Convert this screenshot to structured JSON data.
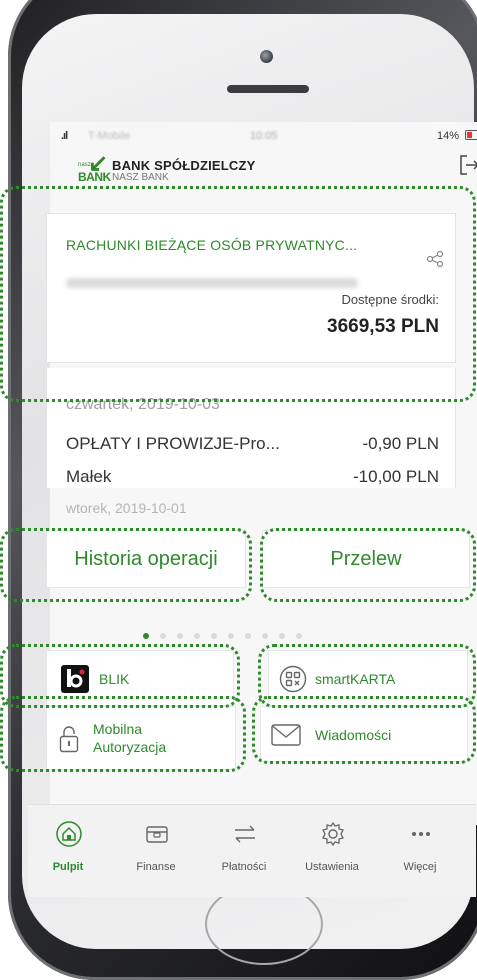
{
  "status_bar": {
    "carrier": "T-Mobile",
    "time": "10:05",
    "battery_pct": "14%"
  },
  "header": {
    "logo_small": "nasz",
    "logo_text": "BANK",
    "bank_name": "BANK SPÓŁDZIELCZY",
    "bank_subname": "NASZ BANK"
  },
  "account": {
    "title": "RACHUNKI BIEŻĄCE OSÓB PRYWATNYC...",
    "available_label": "Dostępne środki:",
    "balance": "3669,53 PLN"
  },
  "transactions": {
    "date1": "czwartek, 2019-10-03",
    "items": [
      {
        "title": "OPŁATY I PROWIZJE-Pro...",
        "amount": "-0,90 PLN"
      },
      {
        "title": "Małek",
        "amount": "-10,00 PLN"
      }
    ],
    "date2": "wtorek, 2019-10-01"
  },
  "actions": {
    "history": "Historia operacji",
    "transfer": "Przelew"
  },
  "tiles": {
    "blik": "BLIK",
    "smartkarta": "smartKARTA",
    "mobile_auth_line1": "Mobilna",
    "mobile_auth_line2": "Autoryzacja",
    "messages": "Wiadomości"
  },
  "pager": {
    "pages": 10,
    "active": 0
  },
  "nav": [
    {
      "label": "Pulpit",
      "icon": "home-icon"
    },
    {
      "label": "Finanse",
      "icon": "wallet-icon"
    },
    {
      "label": "Płatności",
      "icon": "transfer-arrows-icon"
    },
    {
      "label": "Ustawienia",
      "icon": "gear-icon"
    },
    {
      "label": "Więcej",
      "icon": "more-icon"
    }
  ],
  "colors": {
    "accent": "#2e8a2b",
    "highlight": "#2e8a2b"
  }
}
